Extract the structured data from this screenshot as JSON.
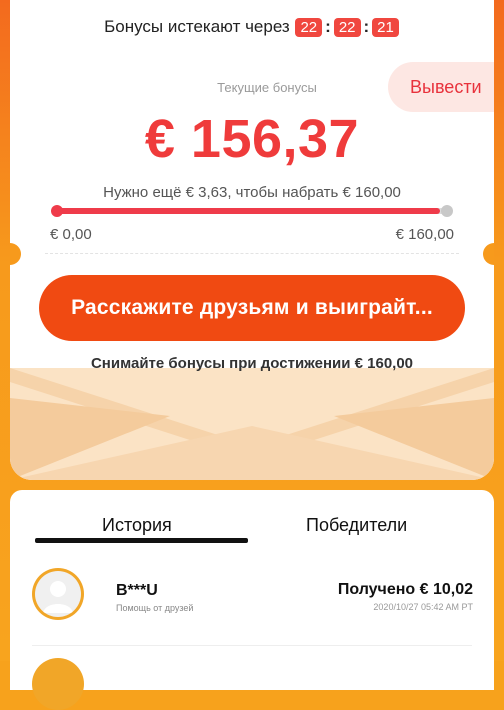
{
  "timer": {
    "label": "Бонусы истекают через",
    "hours": "22",
    "minutes": "22",
    "seconds": "21",
    "separator": ":"
  },
  "withdraw_label": "Вывести",
  "current": {
    "label": "Текущие бонусы",
    "amount": "€ 156,37"
  },
  "progress": {
    "text": "Нужно ещё € 3,63, чтобы набрать € 160,00",
    "min_label": "€ 0,00",
    "max_label": "€ 160,00",
    "value": 0.977
  },
  "cta_label": "Расскажите друзьям и выиграйт...",
  "note": "Снимайте бонусы при достижении € 160,00",
  "tabs": [
    {
      "label": "История",
      "active": true
    },
    {
      "label": "Победители",
      "active": false
    }
  ],
  "history": [
    {
      "name": "B***U",
      "subtitle": "Помощь от друзей",
      "received": "Получено € 10,02",
      "date": "2020/10/27 05:42 AM PT"
    }
  ],
  "colors": {
    "accent": "#ef3b3b",
    "cta": "#f04a12",
    "background": "#f79a1c",
    "timer_box": "#f0473f"
  },
  "icons": {
    "avatar": "user-avatar-icon"
  }
}
